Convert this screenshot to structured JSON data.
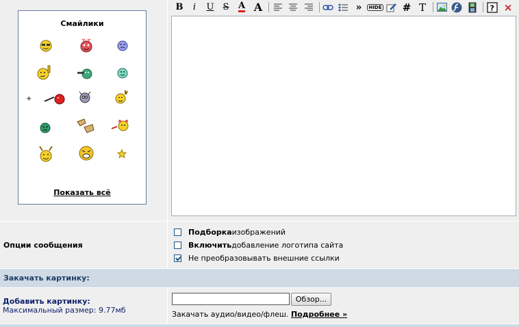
{
  "smilies": {
    "title": "Смайлики",
    "show_all": "Показать всё",
    "plus": "+"
  },
  "toolbar": {
    "bold": "B",
    "italic": "i",
    "underline": "U",
    "strike": "S",
    "font_color": "A",
    "font_size": "A",
    "more": "»",
    "hide": "HIDE",
    "hash": "#",
    "tag": "T",
    "close": "×"
  },
  "options": {
    "label": "Опции сообщения",
    "items": [
      {
        "bold": "Подборка",
        "text": " изображений",
        "checked": false
      },
      {
        "bold": "Включить",
        "text": " добавление логотипа сайта",
        "checked": false
      },
      {
        "bold": "",
        "text": "Не преобразовывать внешние ссылки",
        "checked": true
      }
    ]
  },
  "upload": {
    "header": "Закачать картинку:",
    "add_title": "Добавить картинку:",
    "max_size": "Максимальный размер: 9.77мб",
    "browse_label": "Обзор...",
    "media_text": "Закачать аудио/видео/флеш. ",
    "media_link": "Подробнее »"
  }
}
